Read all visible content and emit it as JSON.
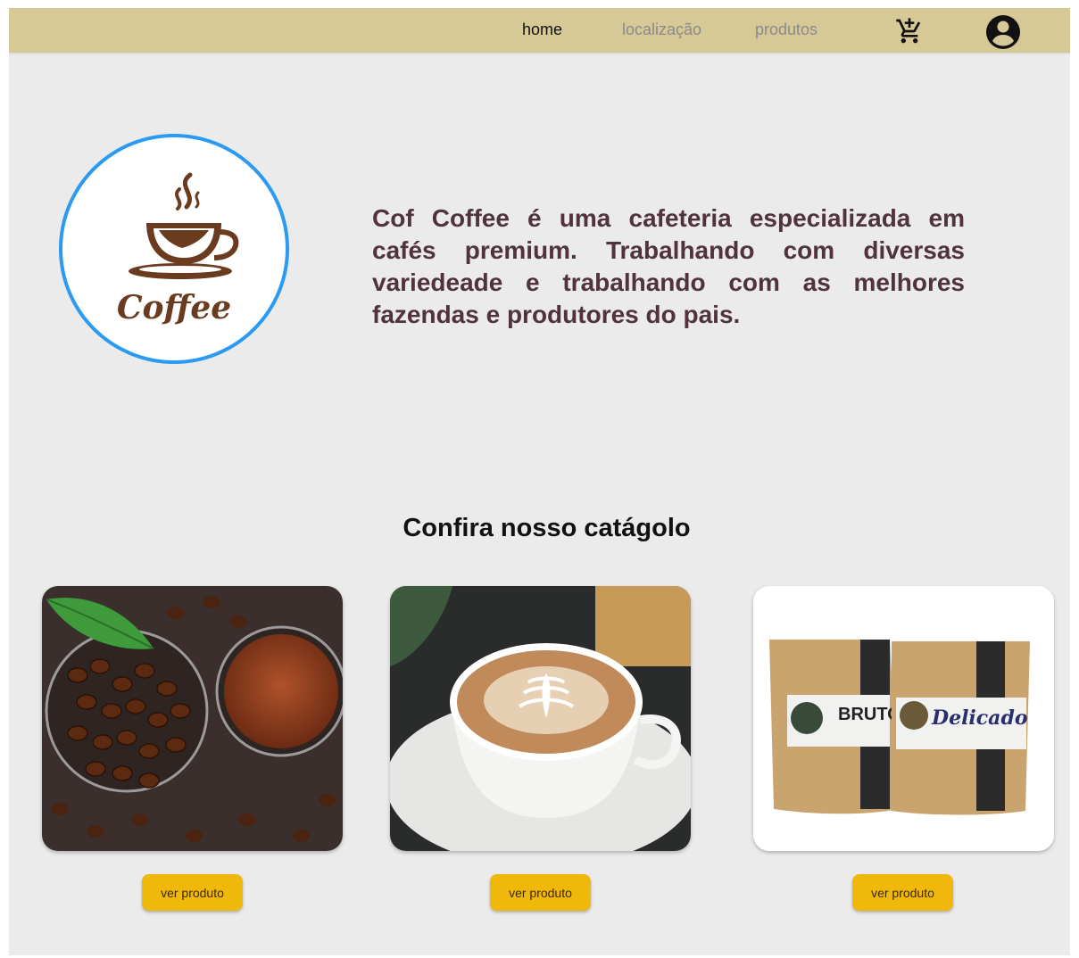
{
  "nav": {
    "links": [
      "home",
      "localização",
      "produtos"
    ],
    "active_index": 0,
    "cart_icon": "cart-plus-icon",
    "account_icon": "account-circle-icon"
  },
  "hero": {
    "logo_text": "Coffee",
    "description": "Cof Coffee é uma cafeteria especializada em cafés premium. Trabalhando com diversas variedeade e trabalhando com as melhores fazendas e produtores do pais."
  },
  "catalog": {
    "title": "Confira nosso catágolo",
    "products": [
      {
        "image": "coffee-beans-and-ground-coffee",
        "button": "ver produto"
      },
      {
        "image": "latte-art-cup",
        "button": "ver produto"
      },
      {
        "image": "coffee-bags-bruto-delicado",
        "button": "ver produto",
        "bag_labels": [
          "BRUTO",
          "Delicado"
        ]
      }
    ]
  },
  "colors": {
    "navbar": "#d6c995",
    "background": "#ebebeb",
    "accent_button": "#f1b80c",
    "logo_ring": "#2b9af3",
    "text_brown": "#50333f"
  }
}
